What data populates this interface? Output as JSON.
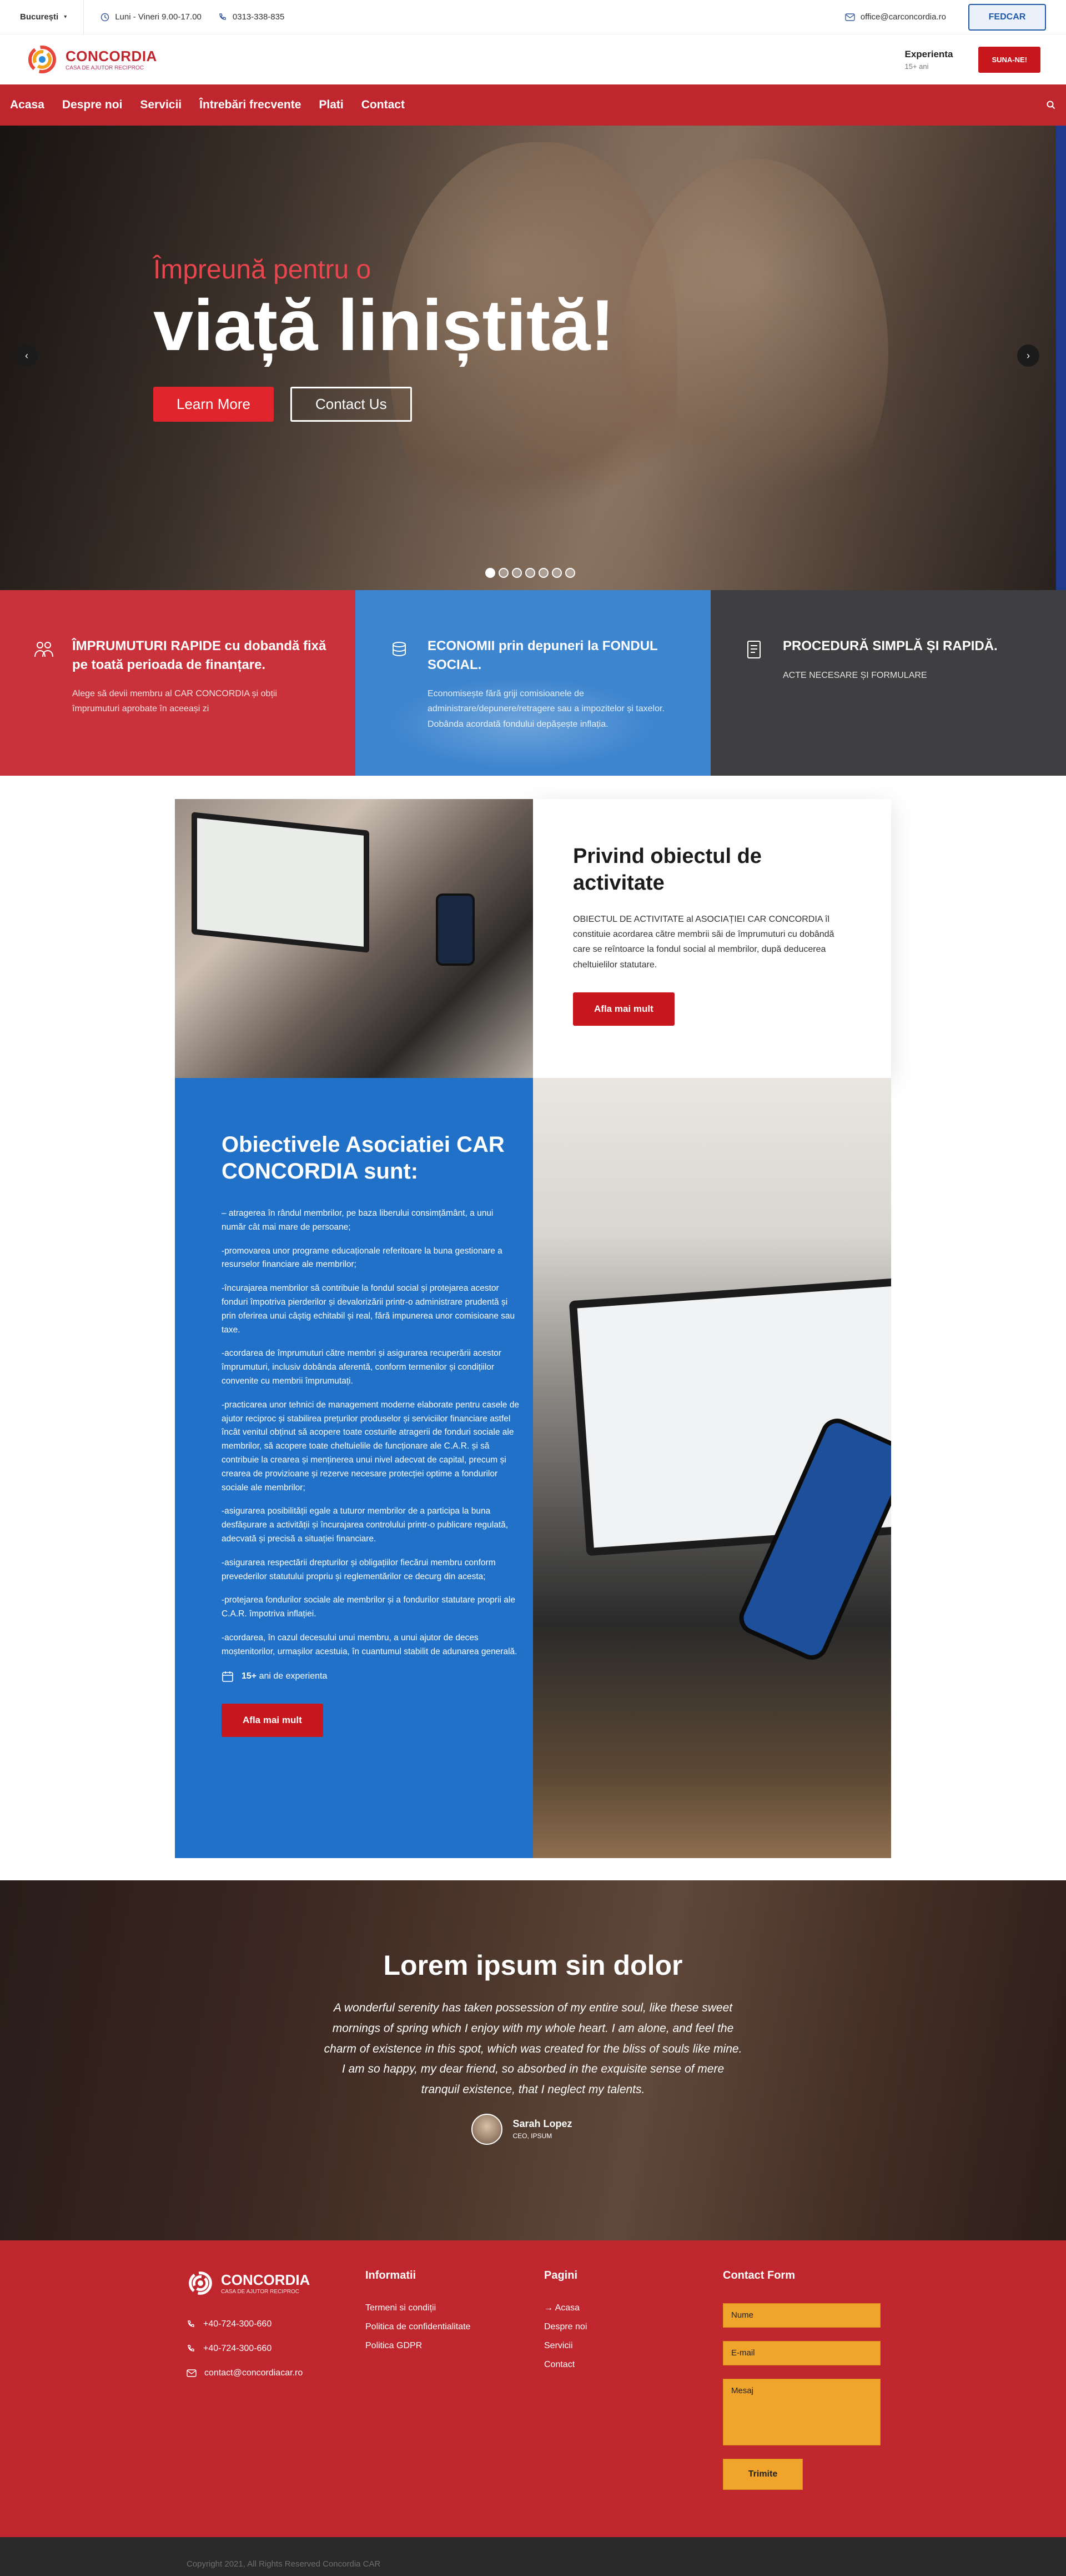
{
  "colors": {
    "primary_red": "#c0262d",
    "button_red": "#c8161d",
    "blue": "#2071c7",
    "orange": "#f0a42b",
    "dark": "#3f3f42"
  },
  "topbar": {
    "city": "București",
    "hours": "Luni - Vineri 9.00-17.00",
    "phone": "0313-338-835",
    "email": "office@carconcordia.ro",
    "partner_logo": "FEDCAR"
  },
  "header": {
    "logo_name": "CONCORDIA",
    "logo_sub": "CASA DE AJUTOR RECIPROC",
    "experience_title": "Experienta",
    "experience_sub": "15+ ani",
    "call_button": "SUNA-NE!"
  },
  "nav": {
    "items": [
      "Acasa",
      "Despre noi",
      "Servicii",
      "Întrebări frecvente",
      "Plati",
      "Contact"
    ],
    "search_icon": "search-icon"
  },
  "hero": {
    "small_title": "Împreună pentru o",
    "big_title": "viață liniștită!",
    "learn_more": "Learn More",
    "contact_us": "Contact Us",
    "slides_count": 7,
    "active_slide": 1
  },
  "features": [
    {
      "title": "ÎMPRUMUTURI RAPIDE cu dobandă fixă pe toată perioada de finanțare.",
      "text": "Alege să devii membru al CAR CONCORDIA și obții împrumuturi aprobate în aceeași zi",
      "icon": "people-icon"
    },
    {
      "title": "ECONOMII prin depuneri la FONDUL SOCIAL.",
      "text": "Economisește fără griji comisioanele de administrare/depunere/retragere sau a impozitelor și taxelor. Dobânda acordată fondului depășește inflația.",
      "icon": "savings-icon"
    },
    {
      "title": "PROCEDURĂ SIMPLĂ ȘI RAPIDĂ.",
      "text": "ACTE NECESARE ȘI FORMULARE",
      "icon": "document-icon"
    }
  ],
  "about": {
    "title": "Privind obiectul de activitate",
    "text": "OBIECTUL DE ACTIVITATE al ASOCIAȚIEI CAR CONCORDIA îl constituie acordarea către membrii săi de împrumuturi cu dobândă care se reîntoarce la fondul social al membrilor, după deducerea cheltuielilor statutare.",
    "button": "Afla mai mult"
  },
  "objectives": {
    "title": "Obiectivele Asociatiei CAR CONCORDIA sunt:",
    "items": [
      "– atragerea în rândul membrilor, pe baza liberului consimțământ, a unui număr cât mai mare de persoane;",
      "-promovarea unor programe educaționale referitoare la buna gestionare a resurselor financiare ale membrilor;",
      "-încurajarea membrilor să contribuie la fondul social și protejarea acestor fonduri împotriva pierderilor și devalorizării printr-o administrare prudentă și prin oferirea unui câștig echitabil și real, fără impunerea unor comisioane sau taxe.",
      "-acordarea de împrumuturi către membri și asigurarea recuperării acestor împrumuturi, inclusiv dobânda aferentă, conform termenilor și condițiilor convenite cu membrii împrumutați.",
      "-practicarea unor tehnici de management moderne elaborate pentru casele de ajutor reciproc și stabilirea prețurilor produselor și serviciilor financiare astfel încât venitul obținut să acopere toate costurile atragerii de fonduri sociale ale membrilor, să acopere toate cheltuielile de funcționare ale C.A.R. și să contribuie la crearea și menținerea unui nivel adecvat de capital, precum și crearea de provizioane și rezerve necesare protecției optime a fondurilor sociale ale membrilor;",
      "-asigurarea posibilității egale a tuturor membrilor de a participa la buna desfășurare a activității și încurajarea controlului printr-o publicare regulată, adecvată și precisă a situației financiare.",
      "-asigurarea respectării drepturilor și obligațiilor fiecărui membru conform prevederilor statutului propriu și reglementărilor ce decurg din acesta;",
      "-protejarea fondurilor sociale ale membrilor și a fondurilor statutare proprii ale C.A.R. împotriva inflației.",
      "-acordarea, în cazul decesului unui membru, a unui ajutor de deces moștenitorilor, urmașilor acestuia, în cuantumul stabilit de adunarea generală."
    ],
    "experience_num": "15+",
    "experience_text": "ani de experienta",
    "button": "Afla mai mult"
  },
  "testimonial": {
    "title": "Lorem ipsum sin dolor",
    "quote": "A wonderful serenity has taken possession of my entire soul, like these sweet mornings of spring which I enjoy with my whole heart. I am alone, and feel the charm of existence in this spot, which was created for the bliss of souls like mine. I am so happy, my dear friend, so absorbed in the exquisite sense of mere tranquil existence, that I neglect my talents.",
    "author": "Sarah Lopez",
    "role": "CEO, IPSUM"
  },
  "footer": {
    "logo_name": "CONCORDIA",
    "logo_sub": "CASA DE AJUTOR RECIPROC",
    "phones": [
      "+40-724-300-660",
      "+40-724-300-660"
    ],
    "email": "contact@concordiacar.ro",
    "info_title": "Informatii",
    "info_links": [
      "Termeni si condiții",
      "Politica de confidentialitate",
      "Politica GDPR"
    ],
    "pages_title": "Pagini",
    "pages_links": [
      "Acasa",
      "Despre noi",
      "Servicii",
      "Contact"
    ],
    "contact_title": "Contact Form",
    "name_placeholder": "Nume",
    "email_placeholder": "E-mail",
    "message_placeholder": "Mesaj",
    "submit": "Trimite",
    "copyright": "Copyright 2021, All Rights Reserved Concordia CAR"
  }
}
